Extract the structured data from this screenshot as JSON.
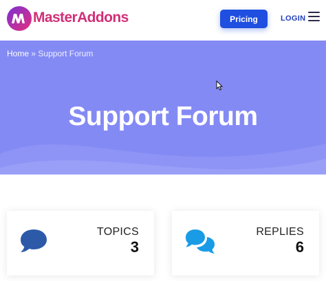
{
  "header": {
    "logo_letters": "MA",
    "brand": "MasterAddons",
    "pricing_label": "Pricing",
    "login_label": "LOGIN"
  },
  "hero": {
    "breadcrumb_home": "Home",
    "breadcrumb_separator": "»",
    "breadcrumb_current": "Support Forum",
    "title": "Support Forum"
  },
  "stats": {
    "topics": {
      "label": "TOPICS",
      "count": "3",
      "icon": "comment-icon",
      "color": "#2d5aa8"
    },
    "replies": {
      "label": "REPLIES",
      "count": "6",
      "icon": "comments-icon",
      "color": "#1a9be6"
    }
  },
  "colors": {
    "brand": "#d12f78",
    "accent": "#1f4fe0",
    "hero_bg": "#848af4"
  }
}
